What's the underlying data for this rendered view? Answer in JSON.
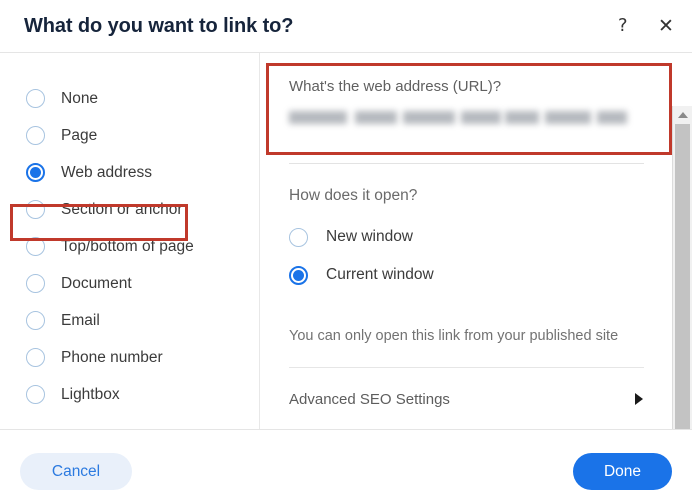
{
  "header": {
    "title": "What do you want to link to?",
    "help_icon": "question-mark-icon",
    "close_icon": "close-icon",
    "help_glyph": "?",
    "close_glyph": "✕"
  },
  "link_types": {
    "selected": "Web address",
    "options": [
      {
        "label": "None",
        "checked": false
      },
      {
        "label": "Page",
        "checked": false
      },
      {
        "label": "Web address",
        "checked": true
      },
      {
        "label": "Section or anchor",
        "checked": false
      },
      {
        "label": "Top/bottom of page",
        "checked": false
      },
      {
        "label": "Document",
        "checked": false
      },
      {
        "label": "Email",
        "checked": false
      },
      {
        "label": "Phone number",
        "checked": false
      },
      {
        "label": "Lightbox",
        "checked": false
      }
    ]
  },
  "url_field": {
    "label": "What's the web address (URL)?",
    "value": "",
    "redacted": true
  },
  "open_behavior": {
    "label": "How does it open?",
    "selected": "Current window",
    "options": [
      {
        "label": "New window",
        "checked": false
      },
      {
        "label": "Current window",
        "checked": true
      }
    ]
  },
  "note": "You can only open this link from your published site",
  "advanced": {
    "label": "Advanced SEO Settings",
    "arrow_icon": "chevron-right-icon"
  },
  "footer": {
    "cancel_label": "Cancel",
    "done_label": "Done"
  },
  "scrollbar": {
    "up_icon": "chevron-up-icon",
    "down_icon": "chevron-down-icon"
  },
  "colors": {
    "accent": "#1a73e8",
    "highlight": "#c0392b",
    "cancel_bg": "#e9f0fa",
    "cancel_text": "#2b7ae0",
    "title": "#16243b"
  }
}
